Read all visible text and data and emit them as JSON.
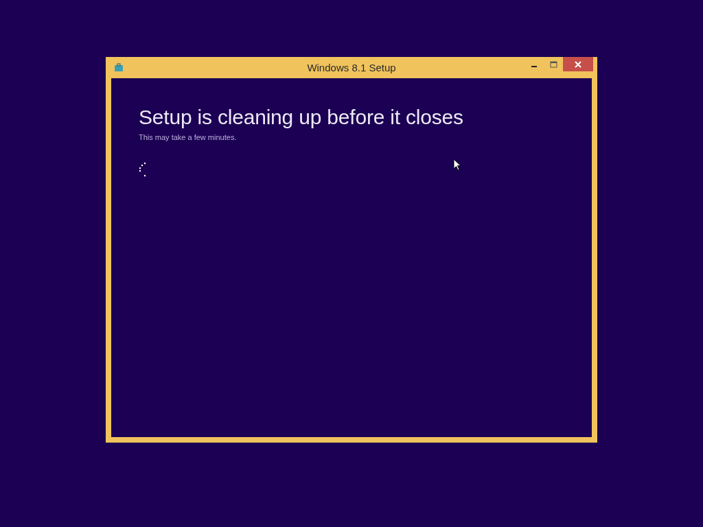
{
  "window": {
    "title": "Windows 8.1 Setup"
  },
  "heading": "Setup is cleaning up before it closes",
  "subtitle": "This may take a few minutes."
}
